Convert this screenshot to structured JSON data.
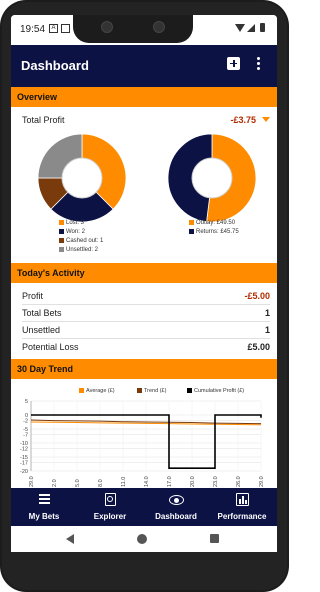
{
  "status": {
    "time": "19:54"
  },
  "appbar": {
    "title": "Dashboard"
  },
  "overview": {
    "heading": "Overview",
    "total_label": "Total Profit",
    "total_value": "-£3.75",
    "colors": {
      "orange": "#ff8c00",
      "navy": "#0d1245",
      "brown": "#7a3b0c",
      "grey": "#8a8a8a"
    },
    "pie1_legend": [
      {
        "label": "Lost: 3",
        "color": "#ff8c00"
      },
      {
        "label": "Won: 2",
        "color": "#0d1245"
      },
      {
        "label": "Cashed out: 1",
        "color": "#7a3b0c"
      },
      {
        "label": "Unsettled: 2",
        "color": "#8a8a8a"
      }
    ],
    "pie2_legend": [
      {
        "label": "Outlay: £49.50",
        "color": "#ff8c00"
      },
      {
        "label": "Returns: £45.75",
        "color": "#0d1245"
      }
    ]
  },
  "activity": {
    "heading": "Today's Activity",
    "rows": [
      {
        "label": "Profit",
        "value": "-£5.00"
      },
      {
        "label": "Total Bets",
        "value": "1"
      },
      {
        "label": "Unsettled",
        "value": "1"
      },
      {
        "label": "Potential Loss",
        "value": "£5.00"
      }
    ]
  },
  "trend": {
    "heading": "30 Day Trend",
    "legend": [
      {
        "label": "Average (£)",
        "color": "#ff8c00"
      },
      {
        "label": "Trend (£)",
        "color": "#7a3b0c"
      },
      {
        "label": "Cumulative Profit (£)",
        "color": "#000000"
      }
    ]
  },
  "chart_data": {
    "type": "line",
    "title": "",
    "xlabel": "",
    "ylabel": "",
    "ylim": [
      -20,
      5
    ],
    "yticks": [
      "5",
      "0",
      "-2",
      "-5",
      "-7",
      "-10",
      "-12",
      "-15",
      "-17",
      "-20"
    ],
    "x": [
      "29.0",
      "2.0",
      "5.0",
      "8.0",
      "11.0",
      "14.0",
      "17.0",
      "20.0",
      "23.0",
      "26.0",
      "29.0"
    ],
    "series": [
      {
        "name": "Average (£)",
        "values": [
          -2.5,
          -2.6,
          -2.7,
          -2.8,
          -2.9,
          -3.0,
          -3.1,
          -3.2,
          -3.3,
          -3.4,
          -3.5
        ]
      },
      {
        "name": "Trend (£)",
        "values": [
          -1.8,
          -2.0,
          -2.1,
          -2.2,
          -2.4,
          -2.5,
          -2.6,
          -2.7,
          -2.9,
          -3.0,
          -3.1
        ]
      },
      {
        "name": "Cumulative Profit (£)",
        "values": [
          0,
          0,
          0,
          0,
          0,
          0,
          -19,
          -19,
          0,
          0,
          -1
        ]
      }
    ]
  },
  "nav": [
    {
      "label": "My Bets"
    },
    {
      "label": "Explorer"
    },
    {
      "label": "Dashboard"
    },
    {
      "label": "Performance"
    }
  ]
}
